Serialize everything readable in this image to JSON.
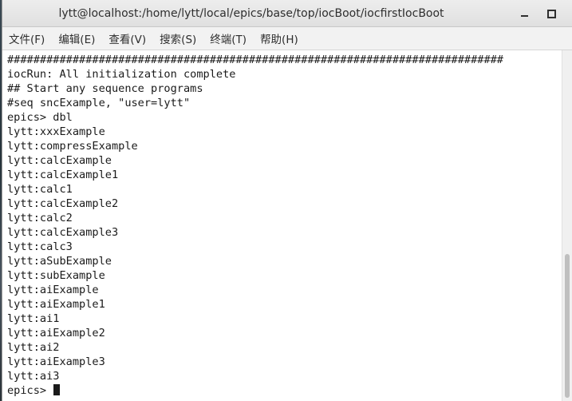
{
  "window": {
    "title": "lytt@localhost:/home/lytt/local/epics/base/top/iocBoot/iocfirstIocBoot"
  },
  "menubar": {
    "items": [
      {
        "label": "文件(F)"
      },
      {
        "label": "编辑(E)"
      },
      {
        "label": "查看(V)"
      },
      {
        "label": "搜索(S)"
      },
      {
        "label": "终端(T)"
      },
      {
        "label": "帮助(H)"
      }
    ]
  },
  "terminal": {
    "lines": [
      "############################################################################",
      "iocRun: All initialization complete",
      "## Start any sequence programs",
      "#seq sncExample, \"user=lytt\"",
      "epics> dbl",
      "lytt:xxxExample",
      "lytt:compressExample",
      "lytt:calcExample",
      "lytt:calcExample1",
      "lytt:calc1",
      "lytt:calcExample2",
      "lytt:calc2",
      "lytt:calcExample3",
      "lytt:calc3",
      "lytt:aSubExample",
      "lytt:subExample",
      "lytt:aiExample",
      "lytt:aiExample1",
      "lytt:ai1",
      "lytt:aiExample2",
      "lytt:ai2",
      "lytt:aiExample3",
      "lytt:ai3"
    ],
    "prompt": "epics> "
  },
  "icons": {
    "minimize": "minimize-icon",
    "maximize": "maximize-icon"
  }
}
